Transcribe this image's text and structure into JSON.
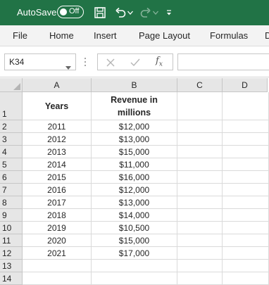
{
  "titlebar": {
    "autosave_label": "AutoSave",
    "autosave_state": "Off"
  },
  "ribbon": {
    "tabs": [
      "File",
      "Home",
      "Insert",
      "Page Layout",
      "Formulas",
      "D"
    ]
  },
  "formula_bar": {
    "name_box": "K34",
    "formula": ""
  },
  "sheet": {
    "columns": [
      "A",
      "B",
      "C",
      "D"
    ],
    "rows": [
      "1",
      "2",
      "3",
      "4",
      "5",
      "6",
      "7",
      "8",
      "9",
      "10",
      "11",
      "12",
      "13",
      "14"
    ],
    "header_row": {
      "years": "Years",
      "revenue_line1": "Revenue in",
      "revenue_line2": "millions"
    },
    "data": [
      {
        "year": "2011",
        "revenue": "$12,000"
      },
      {
        "year": "2012",
        "revenue": "$13,000"
      },
      {
        "year": "2013",
        "revenue": "$15,000"
      },
      {
        "year": "2014",
        "revenue": "$11,000"
      },
      {
        "year": "2015",
        "revenue": "$16,000"
      },
      {
        "year": "2016",
        "revenue": "$12,000"
      },
      {
        "year": "2017",
        "revenue": "$13,000"
      },
      {
        "year": "2018",
        "revenue": "$14,000"
      },
      {
        "year": "2019",
        "revenue": "$10,500"
      },
      {
        "year": "2020",
        "revenue": "$15,000"
      },
      {
        "year": "2021",
        "revenue": "$17,000"
      }
    ]
  },
  "colors": {
    "title_bar": "#217346",
    "ribbon_bg": "#f3f3f3",
    "header_bg": "#e6e6e6",
    "gridline": "#dadada"
  }
}
